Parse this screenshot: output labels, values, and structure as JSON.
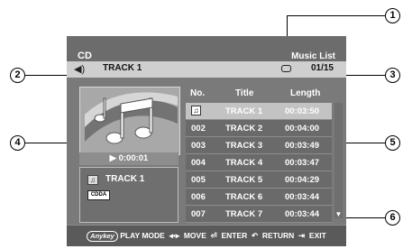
{
  "callouts": [
    "1",
    "2",
    "3",
    "4",
    "5",
    "6"
  ],
  "screen": {
    "mode": "CD",
    "view": "Music List",
    "current_track": "TRACK 1",
    "counter": "01/15",
    "icons": {
      "speaker": "speaker-icon",
      "repeat": "repeat-icon"
    }
  },
  "player": {
    "time": "▶ 0:00:01",
    "track_title": "TRACK 1",
    "format": "CDDA"
  },
  "list": {
    "headers": {
      "no": "No.",
      "title": "Title",
      "length": "Length"
    },
    "rows": [
      {
        "no": "",
        "title": "TRACK 1",
        "length": "00:03:50",
        "selected": true
      },
      {
        "no": "002",
        "title": "TRACK 2",
        "length": "00:04:00"
      },
      {
        "no": "003",
        "title": "TRACK 3",
        "length": "00:03:49"
      },
      {
        "no": "004",
        "title": "TRACK 4",
        "length": "00:03:47"
      },
      {
        "no": "005",
        "title": "TRACK 5",
        "length": "00:04:29"
      },
      {
        "no": "006",
        "title": "TRACK 6",
        "length": "00:03:44"
      },
      {
        "no": "007",
        "title": "TRACK 7",
        "length": "00:03:44"
      }
    ]
  },
  "footer": {
    "anykey": "Anykey",
    "play_mode": "PLAY MODE",
    "move": "MOVE",
    "enter": "ENTER",
    "return": "RETURN",
    "exit": "EXIT"
  }
}
